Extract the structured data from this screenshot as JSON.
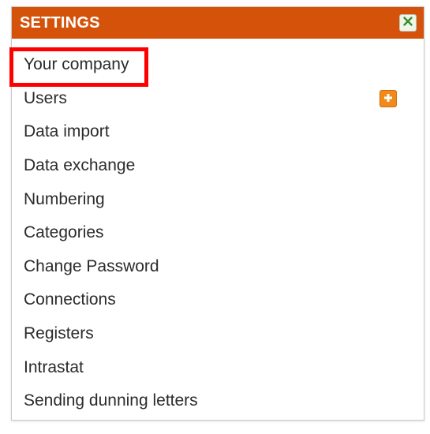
{
  "panel": {
    "title": "SETTINGS",
    "header_color": "#d4520a",
    "close_icon": "close-icon",
    "highlight_color": "#ff0000"
  },
  "menu": {
    "items": [
      {
        "label": "Your company",
        "highlighted": true
      },
      {
        "label": "Users",
        "icon": "add-icon"
      },
      {
        "label": "Data import"
      },
      {
        "label": "Data exchange"
      },
      {
        "label": "Numbering"
      },
      {
        "label": "Categories"
      },
      {
        "label": "Change Password"
      },
      {
        "label": "Connections"
      },
      {
        "label": "Registers"
      },
      {
        "label": "Intrastat"
      },
      {
        "label": "Sending dunning letters"
      }
    ]
  }
}
